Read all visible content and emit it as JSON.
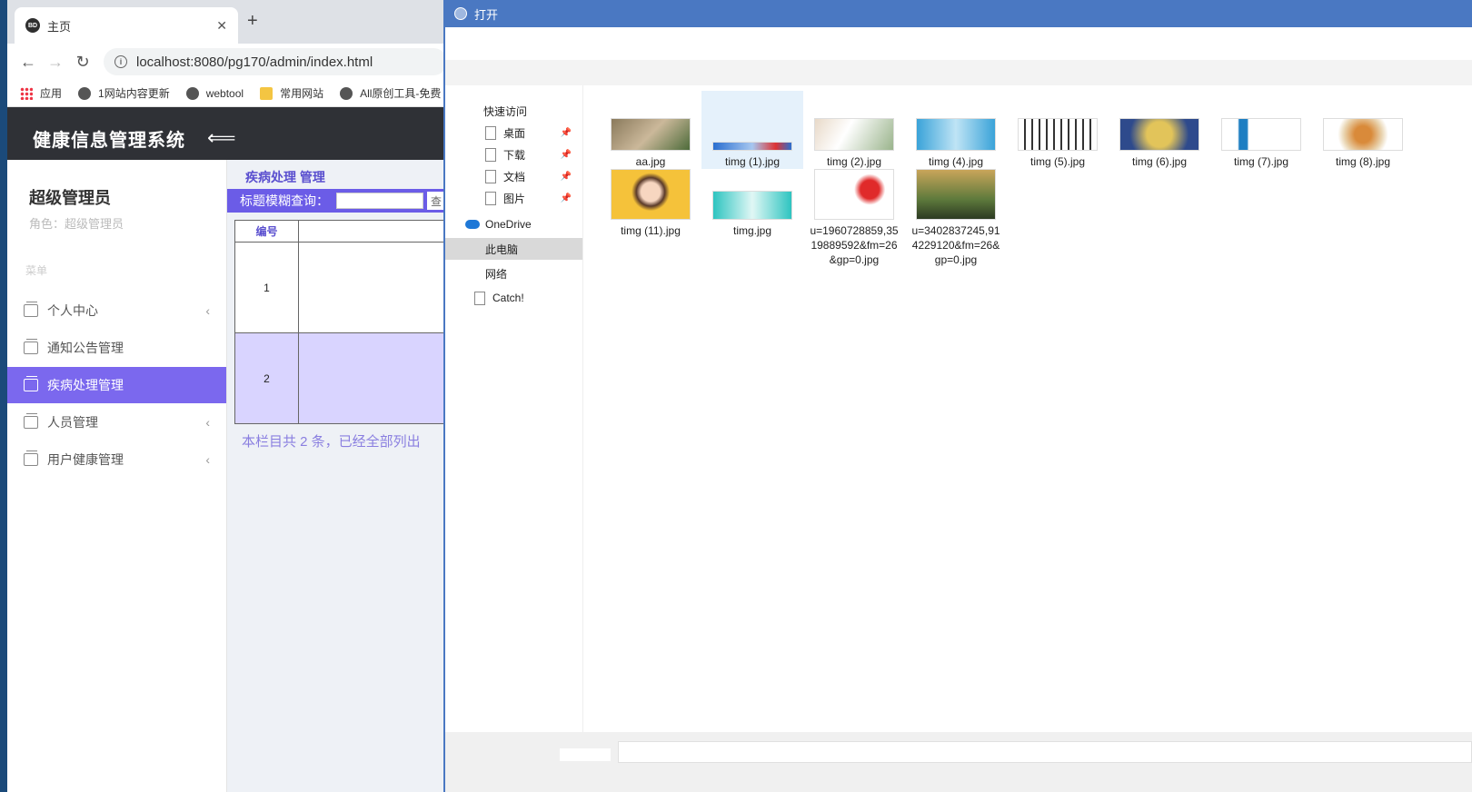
{
  "browser": {
    "tab_title": "主页",
    "tab_favicon": "BD",
    "url": "localhost:8080/pg170/admin/index.html",
    "bookmarks": [
      "应用",
      "1网站内容更新",
      "webtool",
      "常用网站",
      "All原创工具-免费"
    ]
  },
  "app": {
    "title": "健康信息管理系统",
    "user_name": "超级管理员",
    "user_role": "角色：超级管理员",
    "menu_label": "菜单",
    "menu": [
      {
        "label": "个人中心",
        "chevron": "‹"
      },
      {
        "label": "通知公告管理",
        "chevron": ""
      },
      {
        "label": "疾病处理管理",
        "chevron": ""
      },
      {
        "label": "人员管理",
        "chevron": "‹"
      },
      {
        "label": "用户健康管理",
        "chevron": "‹"
      }
    ],
    "content_title": "疾病处理 管理",
    "search_label": "标题模糊查询：",
    "table_header": "编号",
    "rows": [
      "1",
      "2"
    ],
    "footer_note": "本栏目共 2 条，已经全部列出"
  },
  "dialog": {
    "title": "打开",
    "nav": {
      "quick_access": "快速访问",
      "desktop": "桌面",
      "downloads": "下载",
      "documents": "文档",
      "pictures": "图片",
      "onedrive": "OneDrive",
      "this_pc": "此电脑",
      "network": "网络",
      "catch": "Catch!"
    },
    "files": [
      "aa.jpg",
      "timg (1).jpg",
      "timg (2).jpg",
      "timg (4).jpg",
      "timg (5).jpg",
      "timg (6).jpg",
      "timg (7).jpg",
      "timg (8).jpg",
      "timg (11).jpg",
      "timg.jpg",
      "u=1960728859,3519889592&fm=26&gp=0.jpg",
      "u=3402837245,914229120&fm=26&gp=0.jpg"
    ]
  }
}
